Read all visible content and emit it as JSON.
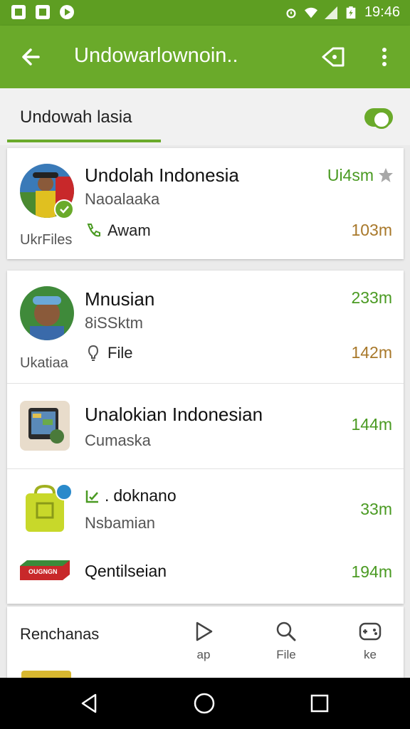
{
  "status_bar": {
    "time": "19:46",
    "icons": [
      "image-icon",
      "photo-icon",
      "play-icon",
      "alarm-icon",
      "wifi-icon",
      "signal-icon",
      "battery-icon"
    ]
  },
  "app_bar": {
    "title": "Undowarlownoin..",
    "icons": [
      "back-arrow-icon",
      "share-icon",
      "more-vert-icon"
    ],
    "color": "#6aaa2a"
  },
  "section": {
    "title": "Undowah lasia",
    "toggle_on": true
  },
  "items": [
    {
      "title": "Undolah Indonesia",
      "subtitle": "Naoalaaka",
      "caption": "UkrFiles",
      "meta_icon": "phone-icon",
      "meta_label": "Awam",
      "size_top": "Ui4sm",
      "size_bottom": "103m",
      "starred": true
    },
    {
      "title": "Mnusian",
      "subtitle": "8iSSktm",
      "caption": "Ukatiaa",
      "meta_icon": "bulb-icon",
      "meta_label": "File",
      "size_top": "233m",
      "size_bottom": "142m"
    },
    {
      "title": "Unalokian Indonesian",
      "subtitle": "Cumaska",
      "size": "144m"
    },
    {
      "title": "doknano",
      "title_icon": "edit-check-icon",
      "subtitle": "Nsbamian",
      "size": "33m"
    },
    {
      "title": "Qentilseian",
      "badge_text": "OUGNGN",
      "size": "194m"
    }
  ],
  "bottom": {
    "title": "Renchanas",
    "tabs": [
      {
        "icon": "play-icon",
        "label": "ap"
      },
      {
        "icon": "search-icon",
        "label": "File"
      },
      {
        "icon": "gamepad-icon",
        "label": "ke"
      }
    ]
  },
  "colors": {
    "primary": "#6aaa2a",
    "status": "#5e9e22",
    "size_green": "#4a9a22",
    "size_amber": "#a8782a"
  }
}
